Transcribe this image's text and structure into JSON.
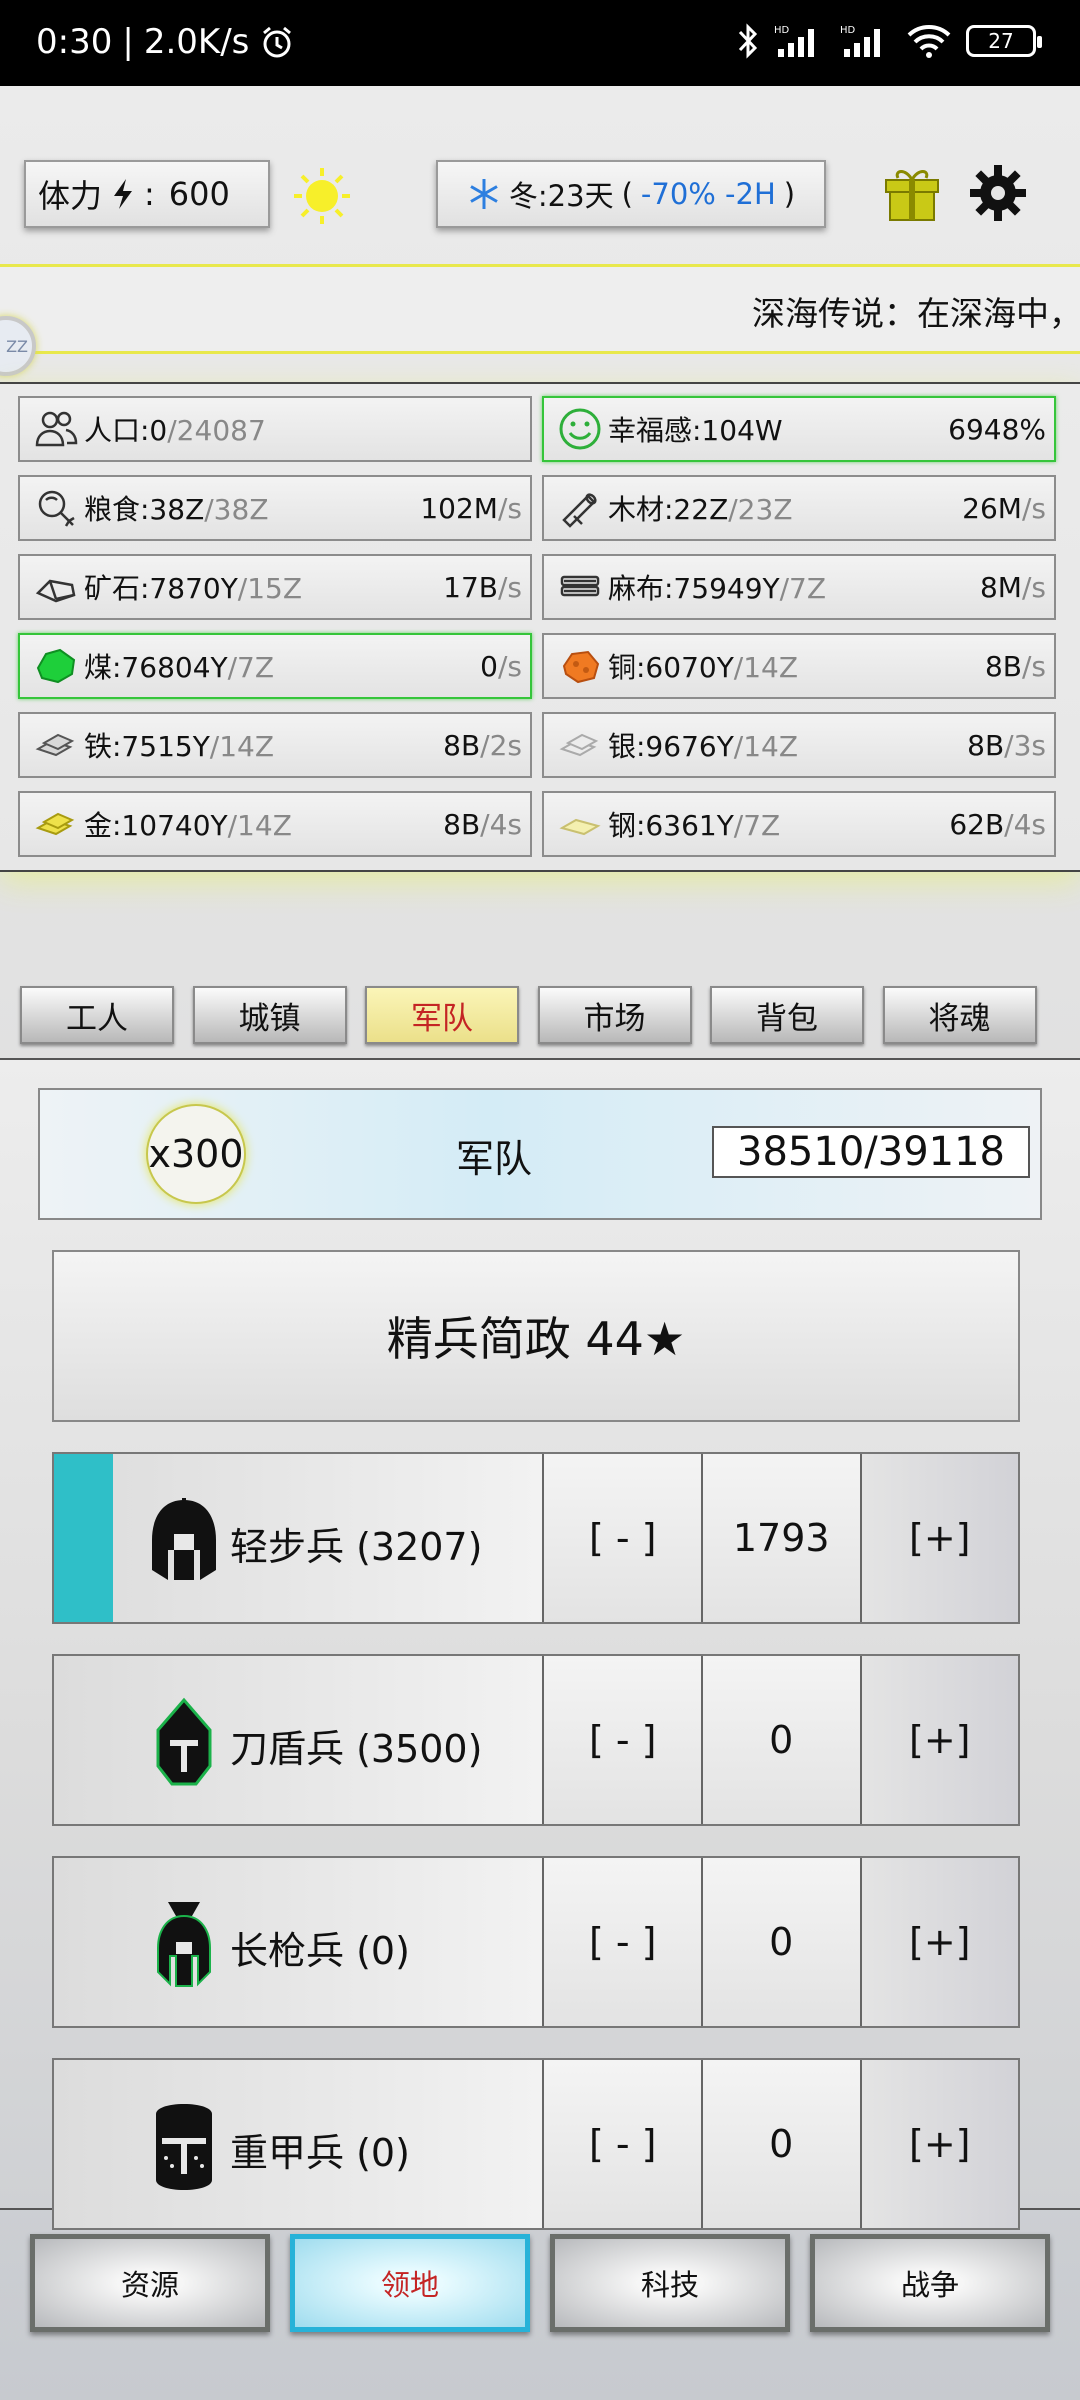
{
  "status_bar": {
    "time": "0:30",
    "speed": "2.0K/s",
    "battery": "27"
  },
  "top": {
    "stamina_label": "体力",
    "stamina_value": "600",
    "season_text": "冬:23天",
    "season_modifier": "-70% -2H"
  },
  "ticker": {
    "text": "深海传说：在深海中，"
  },
  "resources": [
    {
      "icon": "population-icon",
      "name": "人口:0",
      "cap": "/24087",
      "rate": "",
      "unit": "",
      "highlight": false
    },
    {
      "icon": "happy-face-icon",
      "name": "幸福感:104W",
      "cap": "",
      "rate": "6948%",
      "unit": "",
      "highlight": true
    },
    {
      "icon": "food-icon",
      "name": "粮食:38Z",
      "cap": "/38Z",
      "rate": "102M",
      "unit": "/s",
      "highlight": false
    },
    {
      "icon": "wood-icon",
      "name": "木材:22Z",
      "cap": "/23Z",
      "rate": "26M",
      "unit": "/s",
      "highlight": false
    },
    {
      "icon": "ore-icon",
      "name": "矿石:7870Y",
      "cap": "/15Z",
      "rate": "17B",
      "unit": "/s",
      "highlight": false
    },
    {
      "icon": "linen-icon",
      "name": "麻布:75949Y",
      "cap": "/7Z",
      "rate": "8M",
      "unit": "/s",
      "highlight": false
    },
    {
      "icon": "coal-icon",
      "name": "煤:76804Y",
      "cap": "/7Z",
      "rate": "0",
      "unit": "/s",
      "highlight": true
    },
    {
      "icon": "copper-icon",
      "name": "铜:6070Y",
      "cap": "/14Z",
      "rate": "8B",
      "unit": "/s",
      "highlight": false
    },
    {
      "icon": "iron-icon",
      "name": "铁:7515Y",
      "cap": "/14Z",
      "rate": "8B",
      "unit": "/2s",
      "highlight": false
    },
    {
      "icon": "silver-icon",
      "name": "银:9676Y",
      "cap": "/14Z",
      "rate": "8B",
      "unit": "/3s",
      "highlight": false
    },
    {
      "icon": "gold-icon",
      "name": "金:10740Y",
      "cap": "/14Z",
      "rate": "8B",
      "unit": "/4s",
      "highlight": false
    },
    {
      "icon": "steel-icon",
      "name": "钢:6361Y",
      "cap": "/7Z",
      "rate": "62B",
      "unit": "/4s",
      "highlight": false
    }
  ],
  "tabs": [
    "工人",
    "城镇",
    "军队",
    "市场",
    "背包",
    "将魂"
  ],
  "army": {
    "multiplier": "x300",
    "title": "军队",
    "count": "38510/39118",
    "policy": "精兵简政 44★"
  },
  "units": [
    {
      "name": "轻步兵 (3207)",
      "minus": "[ - ]",
      "amount": "1793",
      "plus": "[+]",
      "icon": "spartan-helmet-icon",
      "progress": 0.06
    },
    {
      "name": "刀盾兵 (3500)",
      "minus": "[ - ]",
      "amount": "0",
      "plus": "[+]",
      "icon": "knight-helmet-icon",
      "progress": 0
    },
    {
      "name": "长枪兵 (0)",
      "minus": "[ - ]",
      "amount": "0",
      "plus": "[+]",
      "icon": "crested-helmet-icon",
      "progress": 0
    },
    {
      "name": "重甲兵 (0)",
      "minus": "[ - ]",
      "amount": "0",
      "plus": "[+]",
      "icon": "great-helm-icon",
      "progress": 0
    }
  ],
  "nav": [
    "资源",
    "领地",
    "科技",
    "战争"
  ]
}
